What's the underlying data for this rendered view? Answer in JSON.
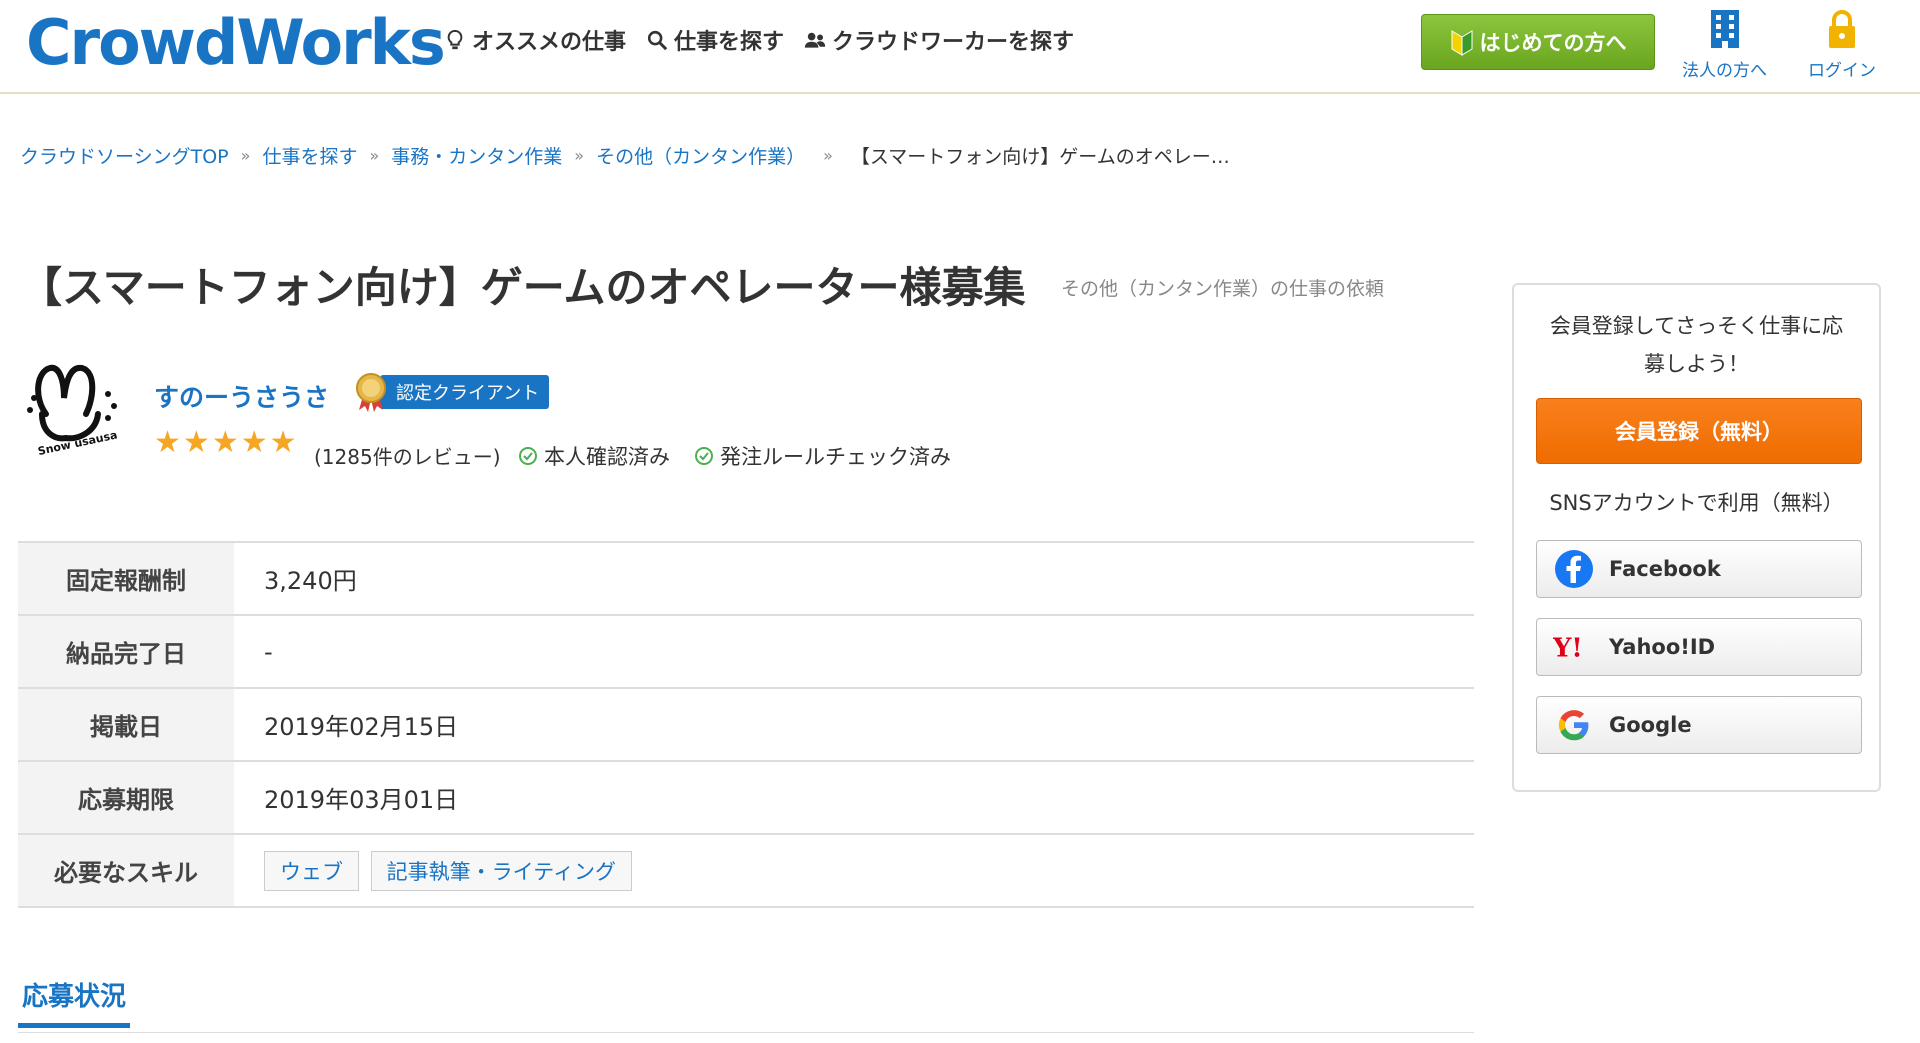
{
  "header": {
    "logo": "CrowdWorks",
    "nav": [
      {
        "label": "オススメの仕事",
        "icon": "lightbulb-icon"
      },
      {
        "label": "仕事を探す",
        "icon": "search-icon"
      },
      {
        "label": "クラウドワーカーを探す",
        "icon": "users-icon"
      }
    ],
    "beginner_button": "はじめての方へ",
    "corporate_link": "法人の方へ",
    "login_link": "ログイン"
  },
  "breadcrumb": {
    "items": [
      "クラウドソーシングTOP",
      "仕事を探す",
      "事務・カンタン作業",
      "その他（カンタン作業）"
    ],
    "separator": "»",
    "current": "【スマートフォン向け】ゲームのオペレー…"
  },
  "job": {
    "title": "【スマートフォン向け】ゲームのオペレーター様募集",
    "subtitle": "その他（カンタン作業）の仕事の依頼"
  },
  "client": {
    "name": "すのーうさうさ",
    "certified_label": "認定クライアント",
    "rating_stars": 5,
    "reviews": "(1285件のレビュー)",
    "identity_verified": "本人確認済み",
    "rules_checked": "発注ルールチェック済み"
  },
  "details": {
    "rows": [
      {
        "label": "固定報酬制",
        "value": "3,240円"
      },
      {
        "label": "納品完了日",
        "value": "-"
      },
      {
        "label": "掲載日",
        "value": "2019年02月15日"
      },
      {
        "label": "応募期限",
        "value": "2019年03月01日"
      }
    ],
    "skills_label": "必要なスキル",
    "skills": [
      "ウェブ",
      "記事執筆・ライティング"
    ]
  },
  "section": {
    "title": "応募状況"
  },
  "sidebar": {
    "lead_line1": "会員登録してさっそく仕事に応",
    "lead_line2": "募しよう！",
    "register_button": "会員登録（無料）",
    "sns_label": "SNSアカウントで利用（無料）",
    "sns_buttons": [
      "Facebook",
      "Yahoo!ID",
      "Google"
    ]
  },
  "colors": {
    "brand": "#1a74c4",
    "register": "#f57c00",
    "beginner": "#7cb82f",
    "star": "#f5a623",
    "check": "#4caf50"
  }
}
